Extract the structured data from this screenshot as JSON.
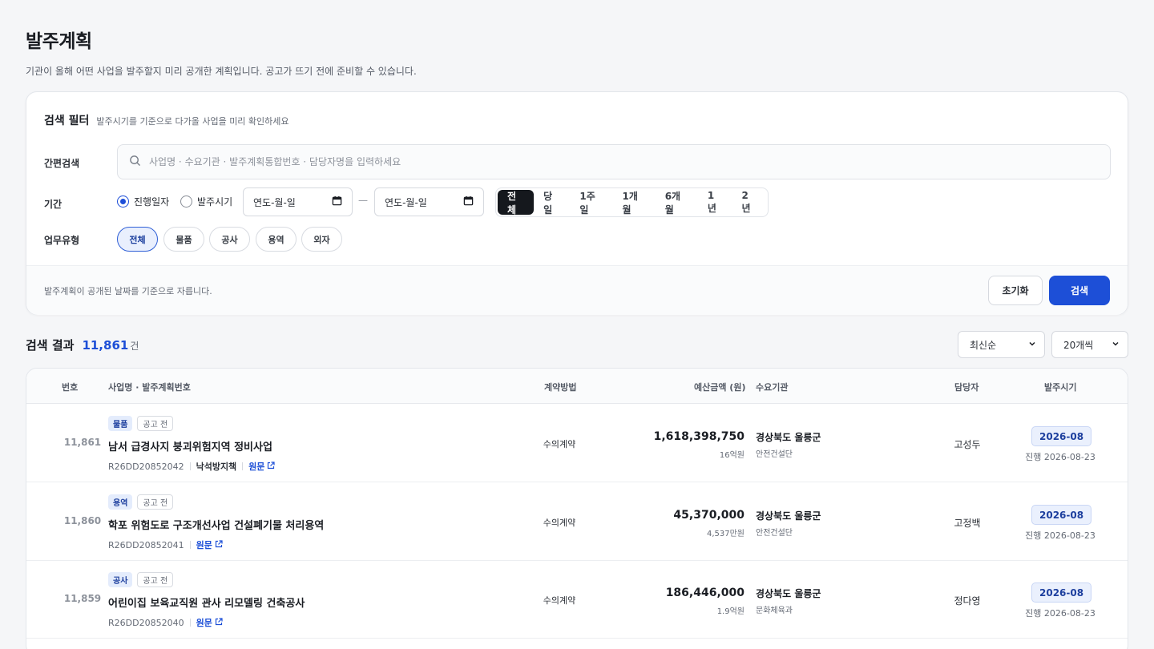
{
  "page": {
    "title": "발주계획",
    "description": "기관이 올해 어떤 사업을 발주할지 미리 공개한 계획입니다. 공고가 뜨기 전에 준비할 수 있습니다."
  },
  "filter": {
    "title": "검색 필터",
    "subtitle": "발주시기를 기준으로 다가올 사업을 미리 확인하세요",
    "quick_search": {
      "label": "간편검색",
      "placeholder": "사업명 · 수요기관 · 발주계획통합번호 · 담당자명을 입력하세요",
      "value": ""
    },
    "period": {
      "label": "기간",
      "radios": [
        {
          "label": "진행일자",
          "checked": true
        },
        {
          "label": "발주시기",
          "checked": false
        }
      ],
      "date_from": "연도-월-일",
      "date_to": "연도-월-일",
      "presets": [
        {
          "label": "전체",
          "active": true
        },
        {
          "label": "당일",
          "active": false
        },
        {
          "label": "1주일",
          "active": false
        },
        {
          "label": "1개월",
          "active": false
        },
        {
          "label": "6개월",
          "active": false
        },
        {
          "label": "1년",
          "active": false
        },
        {
          "label": "2년",
          "active": false
        }
      ]
    },
    "work_type": {
      "label": "업무유형",
      "chips": [
        {
          "label": "전체",
          "active": true
        },
        {
          "label": "물품",
          "active": false
        },
        {
          "label": "공사",
          "active": false
        },
        {
          "label": "용역",
          "active": false
        },
        {
          "label": "외자",
          "active": false
        }
      ]
    },
    "footer_note": "발주계획이 공개된 날짜를 기준으로 자릅니다.",
    "reset_label": "초기화",
    "search_label": "검색"
  },
  "results": {
    "title": "검색 결과",
    "count": "11,861",
    "count_unit": "건",
    "sort": "최신순",
    "page_size": "20개씩",
    "columns": {
      "no": "번호",
      "name": "사업명 · 발주계획번호",
      "method": "계약방법",
      "amount": "예산금액 (원)",
      "agency": "수요기관",
      "manager": "담당자",
      "period": "발주시기"
    },
    "rows": [
      {
        "no": "11,861",
        "category": "물품",
        "status": "공고 전",
        "name": "남서 급경사지 붕괴위험지역 정비사업",
        "plan_no": "R26DD20852042",
        "sub": "낙석방지책",
        "link": "원문",
        "method": "수의계약",
        "amount": "1,618,398,750",
        "amount_short": "16억원",
        "agency": "경상북도 울릉군",
        "agency_sub": "안전건설단",
        "manager": "고성두",
        "period": "2026-08",
        "progress": "진행 2026-08-23"
      },
      {
        "no": "11,860",
        "category": "용역",
        "status": "공고 전",
        "name": "학포 위험도로 구조개선사업 건설폐기물 처리용역",
        "plan_no": "R26DD20852041",
        "sub": "",
        "link": "원문",
        "method": "수의계약",
        "amount": "45,370,000",
        "amount_short": "4,537만원",
        "agency": "경상북도 울릉군",
        "agency_sub": "안전건설단",
        "manager": "고정백",
        "period": "2026-08",
        "progress": "진행 2026-08-23"
      },
      {
        "no": "11,859",
        "category": "공사",
        "status": "공고 전",
        "name": "어린이집 보육교직원 관사 리모델링 건축공사",
        "plan_no": "R26DD20852040",
        "sub": "",
        "link": "원문",
        "method": "수의계약",
        "amount": "186,446,000",
        "amount_short": "1.9억원",
        "agency": "경상북도 울릉군",
        "agency_sub": "문화체육과",
        "manager": "정다영",
        "period": "2026-08",
        "progress": "진행 2026-08-23"
      }
    ]
  },
  "colors": {
    "accent": "#1d4fd7",
    "dark": "#15181d"
  }
}
